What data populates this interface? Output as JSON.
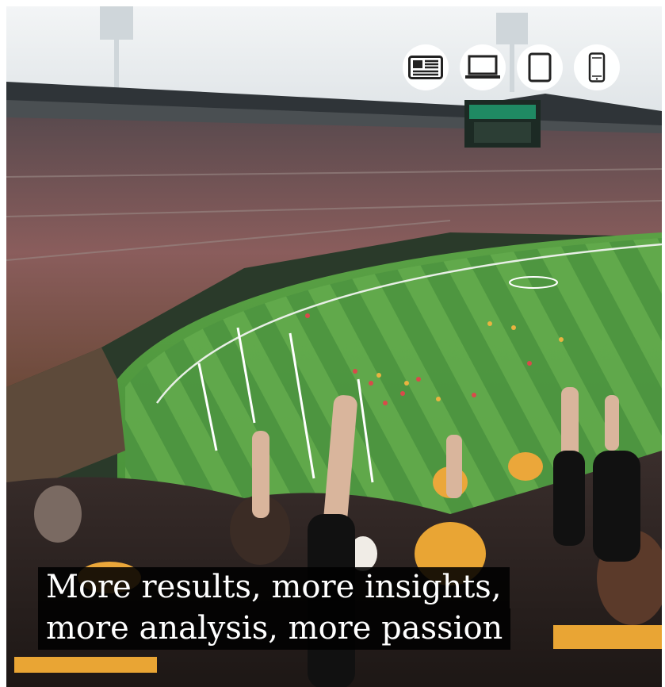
{
  "hero": {
    "image_icon": "stadium-crowd-photo",
    "colors": {
      "sky": "#eef2f4",
      "grass_light": "#5fa34a",
      "grass_dark": "#3f8a34",
      "stand": "#6b5552",
      "crowd_gold": "#e7a83a",
      "caption_bg": "#000000"
    }
  },
  "device_toggle": {
    "items": [
      {
        "icon": "newspaper-icon",
        "label": "print"
      },
      {
        "icon": "laptop-icon",
        "label": "desktop"
      },
      {
        "icon": "tablet-icon",
        "label": "tablet"
      },
      {
        "icon": "smartphone-icon",
        "label": "mobile"
      }
    ]
  },
  "caption": {
    "line1": "More results, more insights,",
    "line2": "more analysis, more passion"
  }
}
